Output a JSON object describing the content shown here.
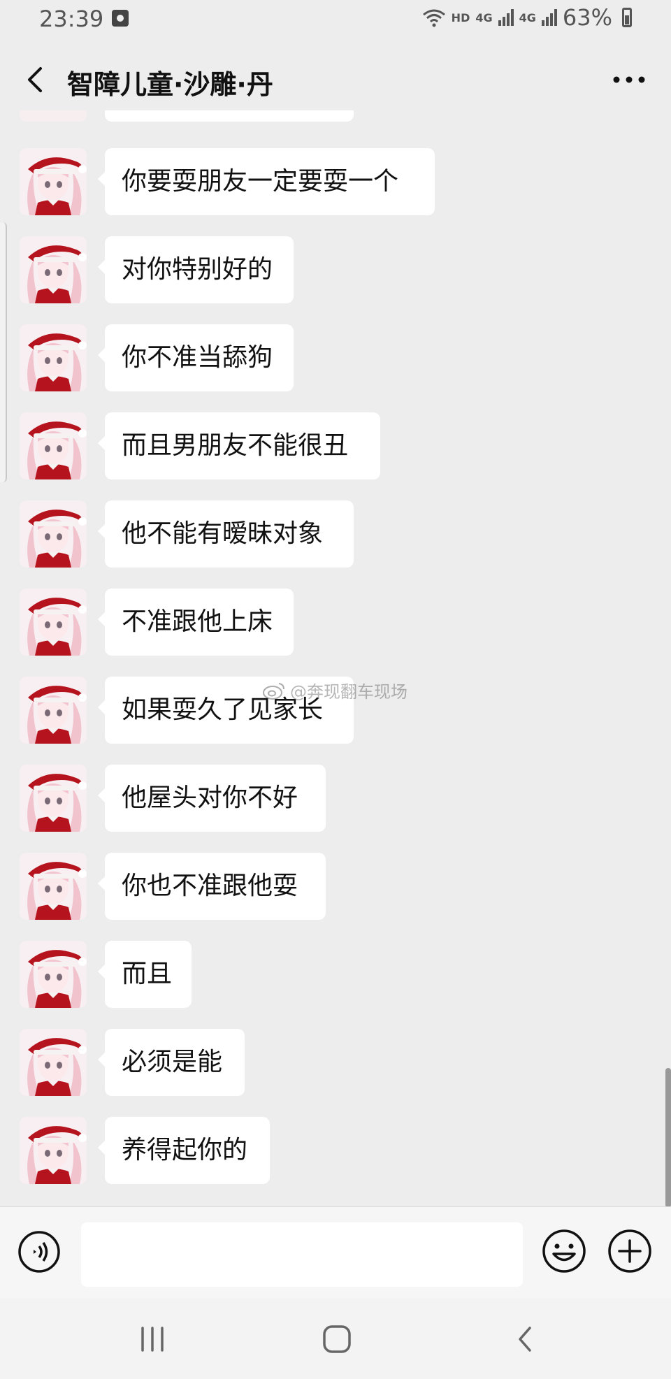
{
  "status_bar": {
    "time": "23:39",
    "network": "HD",
    "net_type_1": "4G",
    "net_type_2": "4G",
    "battery": "63%"
  },
  "header": {
    "title": "智障儿童·沙雕·丹",
    "back_icon": "chevron-left-icon",
    "more_icon": "more-dots-icon"
  },
  "messages": [
    {
      "text": "你要耍朋友一定要耍一个"
    },
    {
      "text": "对你特别好的"
    },
    {
      "text": "你不准当舔狗"
    },
    {
      "text": "而且男朋友不能很丑"
    },
    {
      "text": "他不能有暧昧对象"
    },
    {
      "text": "不准跟他上床"
    },
    {
      "text": "如果耍久了见家长"
    },
    {
      "text": "他屋头对你不好"
    },
    {
      "text": "你也不准跟他耍"
    },
    {
      "text": "而且"
    },
    {
      "text": "必须是能"
    },
    {
      "text": "养得起你的"
    }
  ],
  "watermark": {
    "text": "@奔现翻车现场"
  },
  "input_bar": {
    "value": "",
    "voice_icon": "voice-icon",
    "emoji_icon": "emoji-icon",
    "plus_icon": "plus-icon"
  },
  "nav_bar": {
    "recent_icon": "recent-apps-icon",
    "home_icon": "home-icon",
    "back_icon": "back-icon"
  },
  "colors": {
    "background": "#ededed",
    "bubble": "#ffffff",
    "avatar_red": "#b5141e",
    "avatar_pink": "#f2c4cf"
  }
}
